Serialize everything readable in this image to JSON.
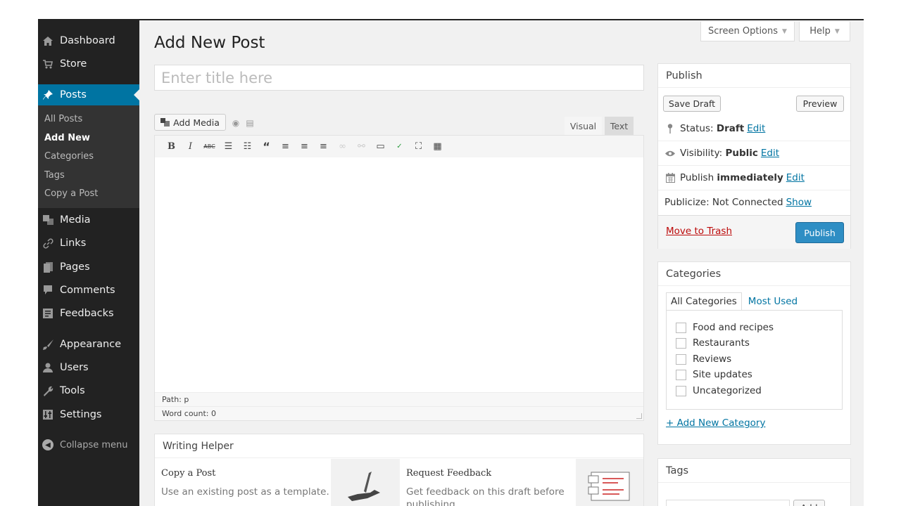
{
  "sidebar": {
    "items": [
      {
        "label": "Dashboard",
        "icon": "home-icon"
      },
      {
        "label": "Store",
        "icon": "cart-icon"
      },
      {
        "label": "Posts",
        "icon": "pin-icon",
        "active": true
      },
      {
        "label": "Media",
        "icon": "media-icon"
      },
      {
        "label": "Links",
        "icon": "link-icon"
      },
      {
        "label": "Pages",
        "icon": "pages-icon"
      },
      {
        "label": "Comments",
        "icon": "comment-icon"
      },
      {
        "label": "Feedbacks",
        "icon": "feedback-icon"
      },
      {
        "label": "Appearance",
        "icon": "brush-icon"
      },
      {
        "label": "Users",
        "icon": "user-icon"
      },
      {
        "label": "Tools",
        "icon": "wrench-icon"
      },
      {
        "label": "Settings",
        "icon": "settings-icon"
      }
    ],
    "submenu": [
      "All Posts",
      "Add New",
      "Categories",
      "Tags",
      "Copy a Post"
    ],
    "collapse_label": "Collapse menu"
  },
  "header": {
    "title": "Add New Post",
    "screen_options": "Screen Options",
    "help": "Help"
  },
  "title_input": {
    "placeholder": "Enter title here"
  },
  "editor": {
    "add_media": "Add Media",
    "tab_visual": "Visual",
    "tab_text": "Text",
    "path": "Path: p",
    "word_count": "Word count: 0"
  },
  "writing_helper": {
    "title": "Writing Helper",
    "copy_title": "Copy a Post",
    "copy_desc": "Use an existing post as a template.",
    "feedback_title": "Request Feedback",
    "feedback_desc": "Get feedback on this draft before publishing."
  },
  "publish": {
    "title": "Publish",
    "save_draft": "Save Draft",
    "preview": "Preview",
    "status_label": "Status:",
    "status_value": "Draft",
    "visibility_label": "Visibility:",
    "visibility_value": "Public",
    "publish_label": "Publish",
    "publish_value": "immediately",
    "publicize_label": "Publicize: Not Connected",
    "show": "Show",
    "edit": "Edit",
    "move_to_trash": "Move to Trash",
    "publish_button": "Publish"
  },
  "categories": {
    "title": "Categories",
    "tab_all": "All Categories",
    "tab_most_used": "Most Used",
    "items": [
      "Food and recipes",
      "Restaurants",
      "Reviews",
      "Site updates",
      "Uncategorized"
    ],
    "add_new": "+ Add New Category"
  },
  "tags": {
    "title": "Tags",
    "add": "Add"
  },
  "colors": {
    "sidebar_bg": "#222222",
    "accent": "#0074a2",
    "publish_button": "#2e8ec4",
    "trash": "#bc0b0b"
  }
}
